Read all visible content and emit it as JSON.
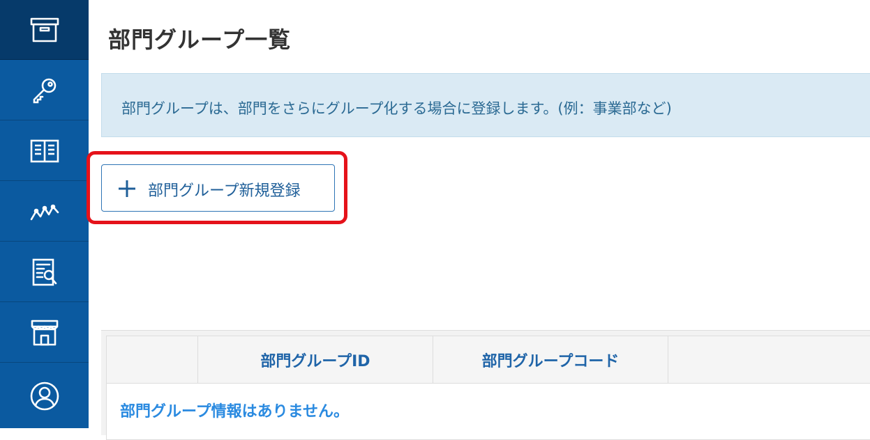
{
  "sidebar": {
    "items": [
      {
        "icon": "archive-box-icon",
        "active": true
      },
      {
        "icon": "key-icon",
        "active": false
      },
      {
        "icon": "book-icon",
        "active": false
      },
      {
        "icon": "line-chart-icon",
        "active": false
      },
      {
        "icon": "report-search-icon",
        "active": false
      },
      {
        "icon": "store-icon",
        "active": false
      },
      {
        "icon": "user-icon",
        "active": false
      }
    ]
  },
  "page": {
    "title": "部門グループ一覧",
    "info": "部門グループは、部門をさらにグループ化する場合に登録します。(例：事業部など)"
  },
  "actions": {
    "add_label": "部門グループ新規登録"
  },
  "table": {
    "columns": [
      "",
      "部門グループID",
      "部門グループコード",
      ""
    ],
    "empty_message": "部門グループ情報はありません。"
  },
  "colors": {
    "sidebar": "#0b5aa0",
    "sidebar_active": "#063a6a",
    "highlight": "#e5121a",
    "accent": "#1f64a8"
  }
}
